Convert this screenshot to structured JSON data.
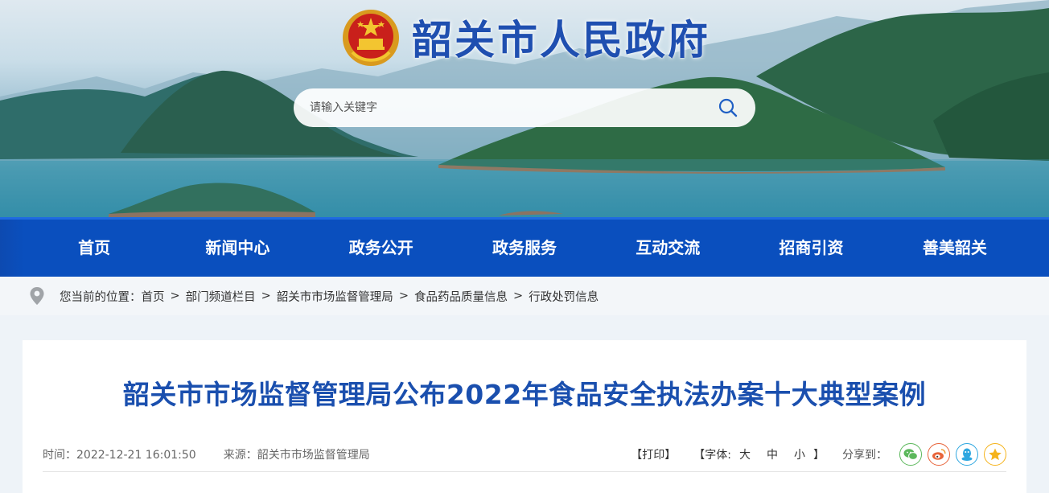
{
  "header": {
    "site_title": "韶关市人民政府",
    "search_placeholder": "请输入关键字"
  },
  "nav": {
    "items": [
      "首页",
      "新闻中心",
      "政务公开",
      "政务服务",
      "互动交流",
      "招商引资",
      "善美韶关"
    ]
  },
  "breadcrumb": {
    "prefix": "您当前的位置：",
    "items": [
      "首页",
      "部门频道栏目",
      "韶关市市场监督管理局",
      "食品药品质量信息",
      "行政处罚信息"
    ],
    "separator": ">"
  },
  "article": {
    "title": "韶关市市场监督管理局公布2022年食品安全执法办案十大典型案例",
    "time_label": "时间：",
    "time": "2022-12-21 16:01:50",
    "source_label": "来源：",
    "source": "韶关市市场监督管理局"
  },
  "tools": {
    "print_label": "【打印】",
    "font_open": "【字体:",
    "font_large": "大",
    "font_medium": "中",
    "font_small": "小",
    "font_close": "】",
    "share_label": "分享到：",
    "share_icons": [
      "wechat-icon",
      "weibo-icon",
      "qq-icon",
      "qzone-icon"
    ]
  },
  "colors": {
    "nav_bg": "#0a4fbe",
    "title_blue": "#1a4fae",
    "brand_blue": "#1f4fb0"
  }
}
